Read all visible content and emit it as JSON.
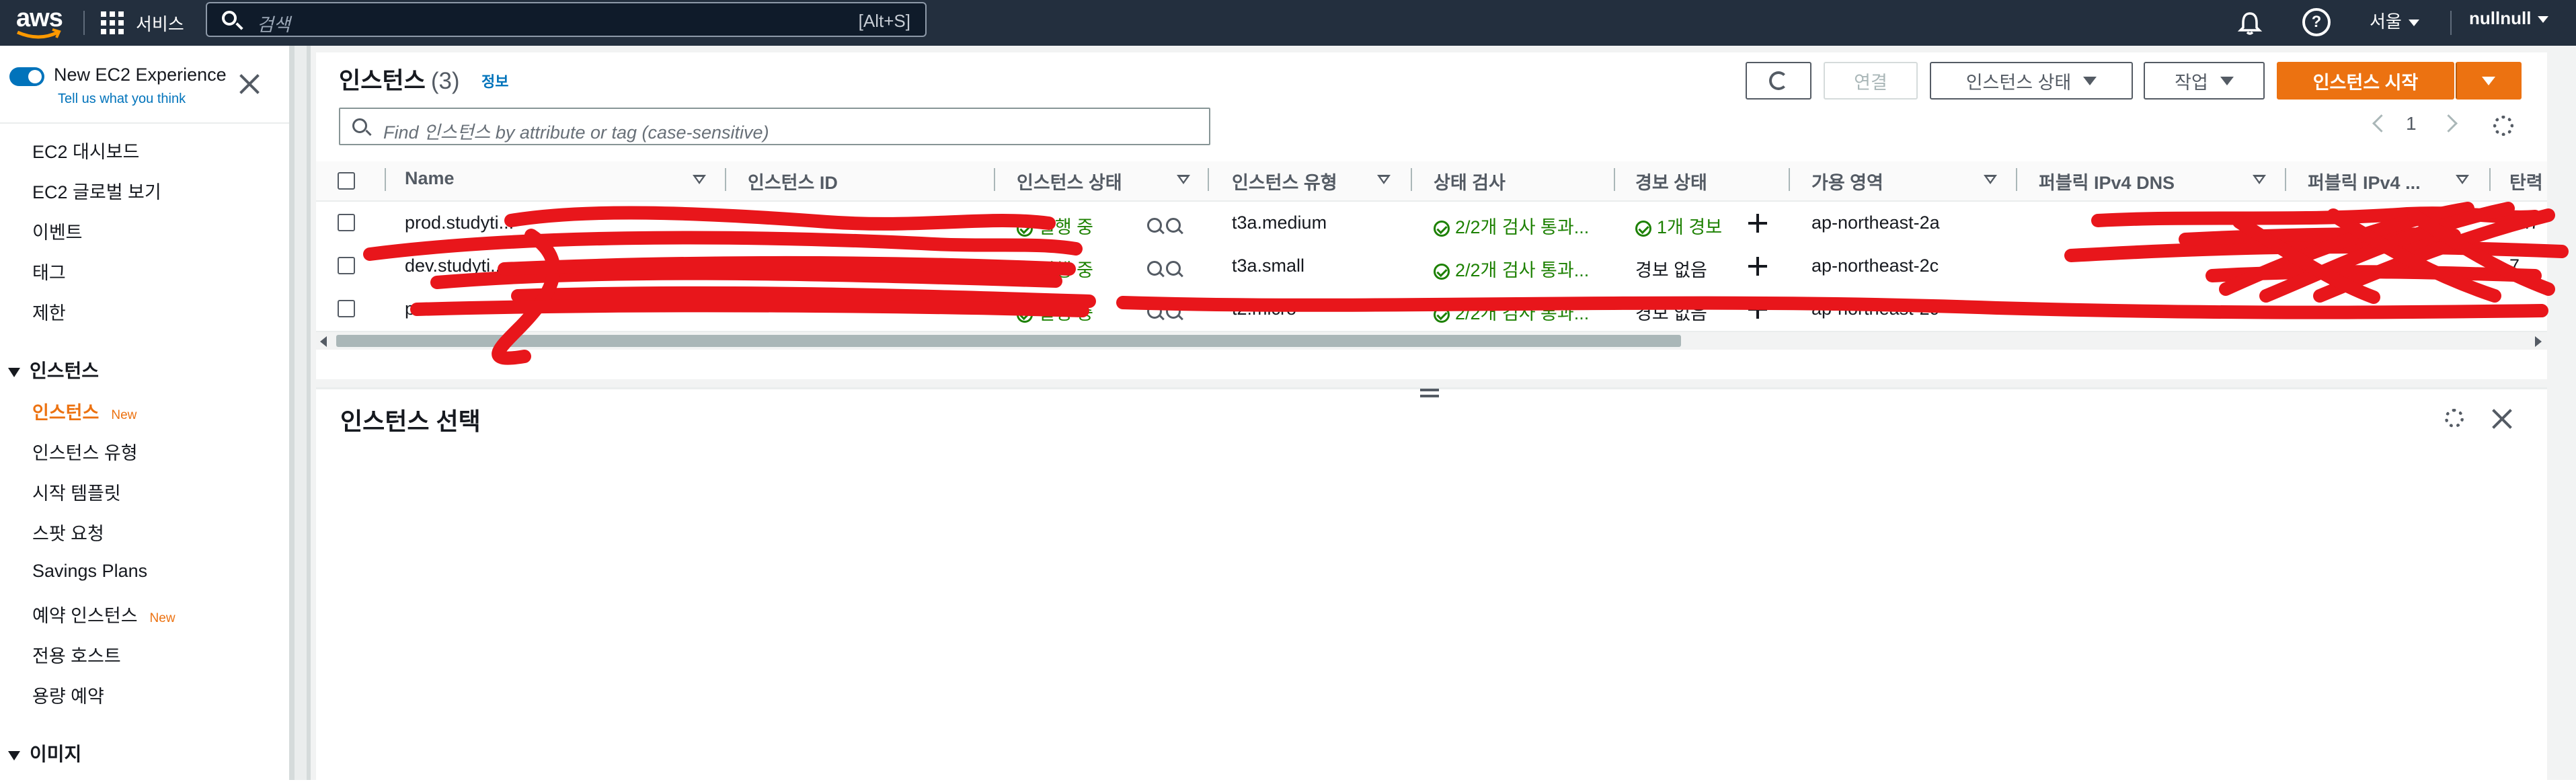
{
  "topnav": {
    "logo_text": "aws",
    "services_label": "서비스",
    "search_placeholder": "검색",
    "search_shortcut": "[Alt+S]",
    "region": "서울",
    "user": "nullnull"
  },
  "sidebar": {
    "experience_title": "New EC2 Experience",
    "experience_link": "Tell us what you think",
    "top_items": [
      {
        "label": "EC2 대시보드"
      },
      {
        "label": "EC2 글로벌 보기"
      },
      {
        "label": "이벤트"
      },
      {
        "label": "태그"
      },
      {
        "label": "제한"
      }
    ],
    "section_instances": "인스턴스",
    "instance_items": [
      {
        "label": "인스턴스",
        "badge": "New"
      },
      {
        "label": "인스턴스 유형"
      },
      {
        "label": "시작 템플릿"
      },
      {
        "label": "스팟 요청"
      },
      {
        "label": "Savings Plans"
      },
      {
        "label": "예약 인스턴스",
        "badge": "New"
      },
      {
        "label": "전용 호스트"
      },
      {
        "label": "용량 예약"
      }
    ],
    "section_images": "이미지"
  },
  "main": {
    "title": "인스턴스",
    "count": "(3)",
    "info": "정보",
    "buttons": {
      "connect": "연결",
      "instance_state": "인스턴스 상태",
      "actions": "작업",
      "launch": "인스턴스 시작"
    },
    "filter_placeholder": "Find 인스턴스 by attribute or tag (case-sensitive)",
    "page_number": "1",
    "columns": [
      "Name",
      "인스턴스 ID",
      "인스턴스 상태",
      "인스턴스 유형",
      "상태 검사",
      "경보 상태",
      "가용 영역",
      "퍼블릭 IPv4 DNS",
      "퍼블릭 IPv4 ...",
      "탄력"
    ],
    "rows": [
      {
        "name": "prod.studyti...",
        "state": "실행 중",
        "type": "t3a.medium",
        "check": "2/2개 검사 통과...",
        "alarm": "1개 경보",
        "alarm_ok": true,
        "az": "ap-northeast-2a",
        "tail": ".2.7"
      },
      {
        "name": "dev.studyti...",
        "state": "실행 중",
        "type": "t3a.small",
        "check": "2/2개 검사 통과...",
        "alarm": "경보 없음",
        "alarm_ok": false,
        "az": "ap-northeast-2c",
        "tail": "7"
      },
      {
        "name": "pro...",
        "state": "실행 중",
        "type": "t2.micro",
        "check": "2/2개 검사 통과...",
        "alarm": "경보 없음",
        "alarm_ok": false,
        "az": "ap-northeast-2c",
        "tail": "–"
      }
    ]
  },
  "bottom": {
    "title": "인스턴스 선택"
  },
  "colors": {
    "nav_bg": "#232f3e",
    "primary": "#ec7211",
    "link": "#0073bb",
    "success": "#1d8102",
    "redaction": "#e8161b"
  }
}
